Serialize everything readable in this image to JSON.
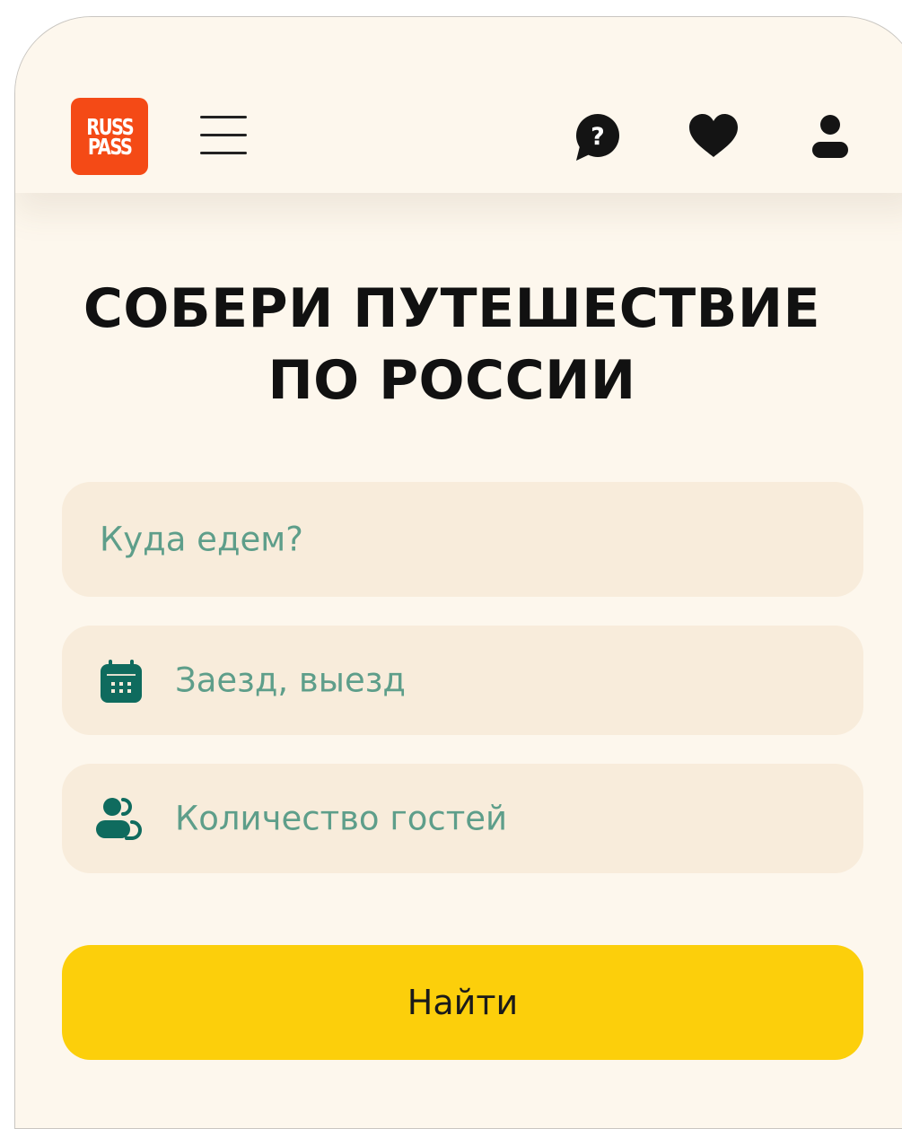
{
  "header": {
    "logo_line1": "RUSS",
    "logo_line2": "PASS",
    "icons": {
      "menu": "menu-icon",
      "help": "help-chat-icon",
      "favorites": "heart-icon",
      "profile": "user-icon"
    }
  },
  "hero": {
    "title_line1": "СОБЕРИ ПУТЕШЕСТВИЕ",
    "title_line2": "ПО РОССИИ"
  },
  "search": {
    "destination_placeholder": "Куда едем?",
    "dates_placeholder": "Заезд, выезд",
    "guests_placeholder": "Количество гостей",
    "submit_label": "Найти"
  },
  "colors": {
    "background": "#fdf7ed",
    "field_background": "#f8ecdb",
    "placeholder_text": "#5e9e8a",
    "icon_accent": "#0f6b5e",
    "logo_red": "#f44a16",
    "button_yellow": "#fccf0b",
    "text_dark": "#111111"
  }
}
